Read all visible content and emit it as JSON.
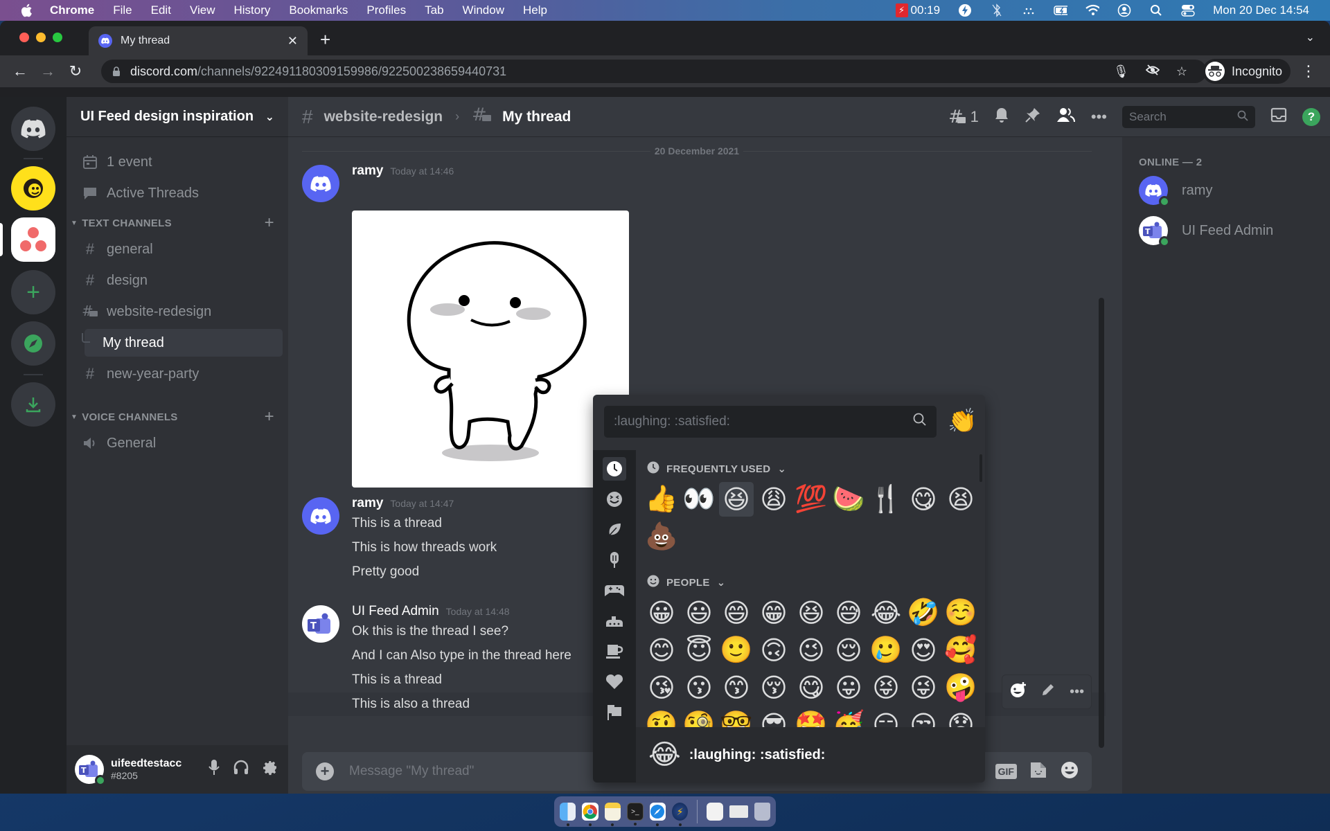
{
  "menubar": {
    "app_name": "Chrome",
    "items": [
      "File",
      "Edit",
      "View",
      "History",
      "Bookmarks",
      "Profiles",
      "Tab",
      "Window",
      "Help"
    ],
    "recording_time": "00:19",
    "datetime": "Mon 20 Dec  14:54"
  },
  "browser": {
    "tab_title": "My thread",
    "url_host": "discord.com",
    "url_path": "/channels/922491180309159986/922500238659440731",
    "profile_label": "Incognito"
  },
  "server": {
    "name": "UI Feed design inspiration",
    "events_label": "1 event",
    "active_threads_label": "Active Threads",
    "text_category": "TEXT CHANNELS",
    "voice_category": "VOICE CHANNELS",
    "channels": [
      {
        "name": "general",
        "type": "text"
      },
      {
        "name": "design",
        "type": "text"
      },
      {
        "name": "website-redesign",
        "type": "text-threads"
      },
      {
        "name": "My thread",
        "type": "thread",
        "active": true
      },
      {
        "name": "new-year-party",
        "type": "text-rules"
      }
    ],
    "voice_channels": [
      {
        "name": "General"
      }
    ]
  },
  "user": {
    "username": "uifeedtestacc",
    "discriminator": "#8205"
  },
  "chat": {
    "parent_channel": "website-redesign",
    "thread_name": "My thread",
    "threads_count": "1",
    "search_placeholder": "Search",
    "date_divider": "20 December 2021",
    "messages": [
      {
        "author": "ramy",
        "time": "Today at 14:46",
        "lines": [],
        "has_image": true
      },
      {
        "author": "ramy",
        "time": "Today at 14:47",
        "lines": [
          "This is a thread",
          "This is how threads work",
          "Pretty good"
        ]
      },
      {
        "author": "UI Feed Admin",
        "time": "Today at 14:48",
        "lines": [
          "Ok this is the thread I see?",
          "And I can Also type in the thread here",
          "This is a thread",
          "This is also a thread"
        ]
      }
    ],
    "composer_placeholder": "Message \"My thread\"",
    "gif_label": "GIF"
  },
  "members": {
    "category": "ONLINE — 2",
    "list": [
      {
        "name": "ramy",
        "status": "online"
      },
      {
        "name": "UI Feed Admin",
        "status": "online"
      }
    ]
  },
  "emoji_picker": {
    "search_value": ":laughing: :satisfied:",
    "clap": "👏",
    "frequently_used_label": "FREQUENTLY USED",
    "people_label": "PEOPLE",
    "frequently_used": [
      "👍",
      "👀",
      "😆",
      "😩",
      "💯",
      "🍉",
      "🍴",
      "😋",
      "😫",
      "💩"
    ],
    "people": [
      "😀",
      "😃",
      "😄",
      "😁",
      "😆",
      "😅",
      "😂",
      "🤣",
      "☺️",
      "😊",
      "😇",
      "🙂",
      "🙃",
      "😉",
      "😌",
      "🥲",
      "😍",
      "🥰",
      "😘",
      "😗",
      "😙",
      "😚",
      "😋",
      "😛",
      "😝",
      "😜",
      "🤪",
      "🤨",
      "🧐",
      "🤓",
      "😎",
      "🤩",
      "🥳",
      "😏",
      "😒",
      "😞"
    ],
    "hovered_index": 2,
    "preview_emoji": "😂",
    "preview_name": ":laughing: :satisfied:",
    "categories": [
      "recent",
      "people",
      "nature",
      "food",
      "activity",
      "travel",
      "objects",
      "symbols",
      "flags"
    ]
  },
  "colors": {
    "blurple": "#5865f2",
    "online": "#3ba55d",
    "bg_primary": "#36393f",
    "bg_secondary": "#2f3136",
    "bg_tertiary": "#202225"
  }
}
